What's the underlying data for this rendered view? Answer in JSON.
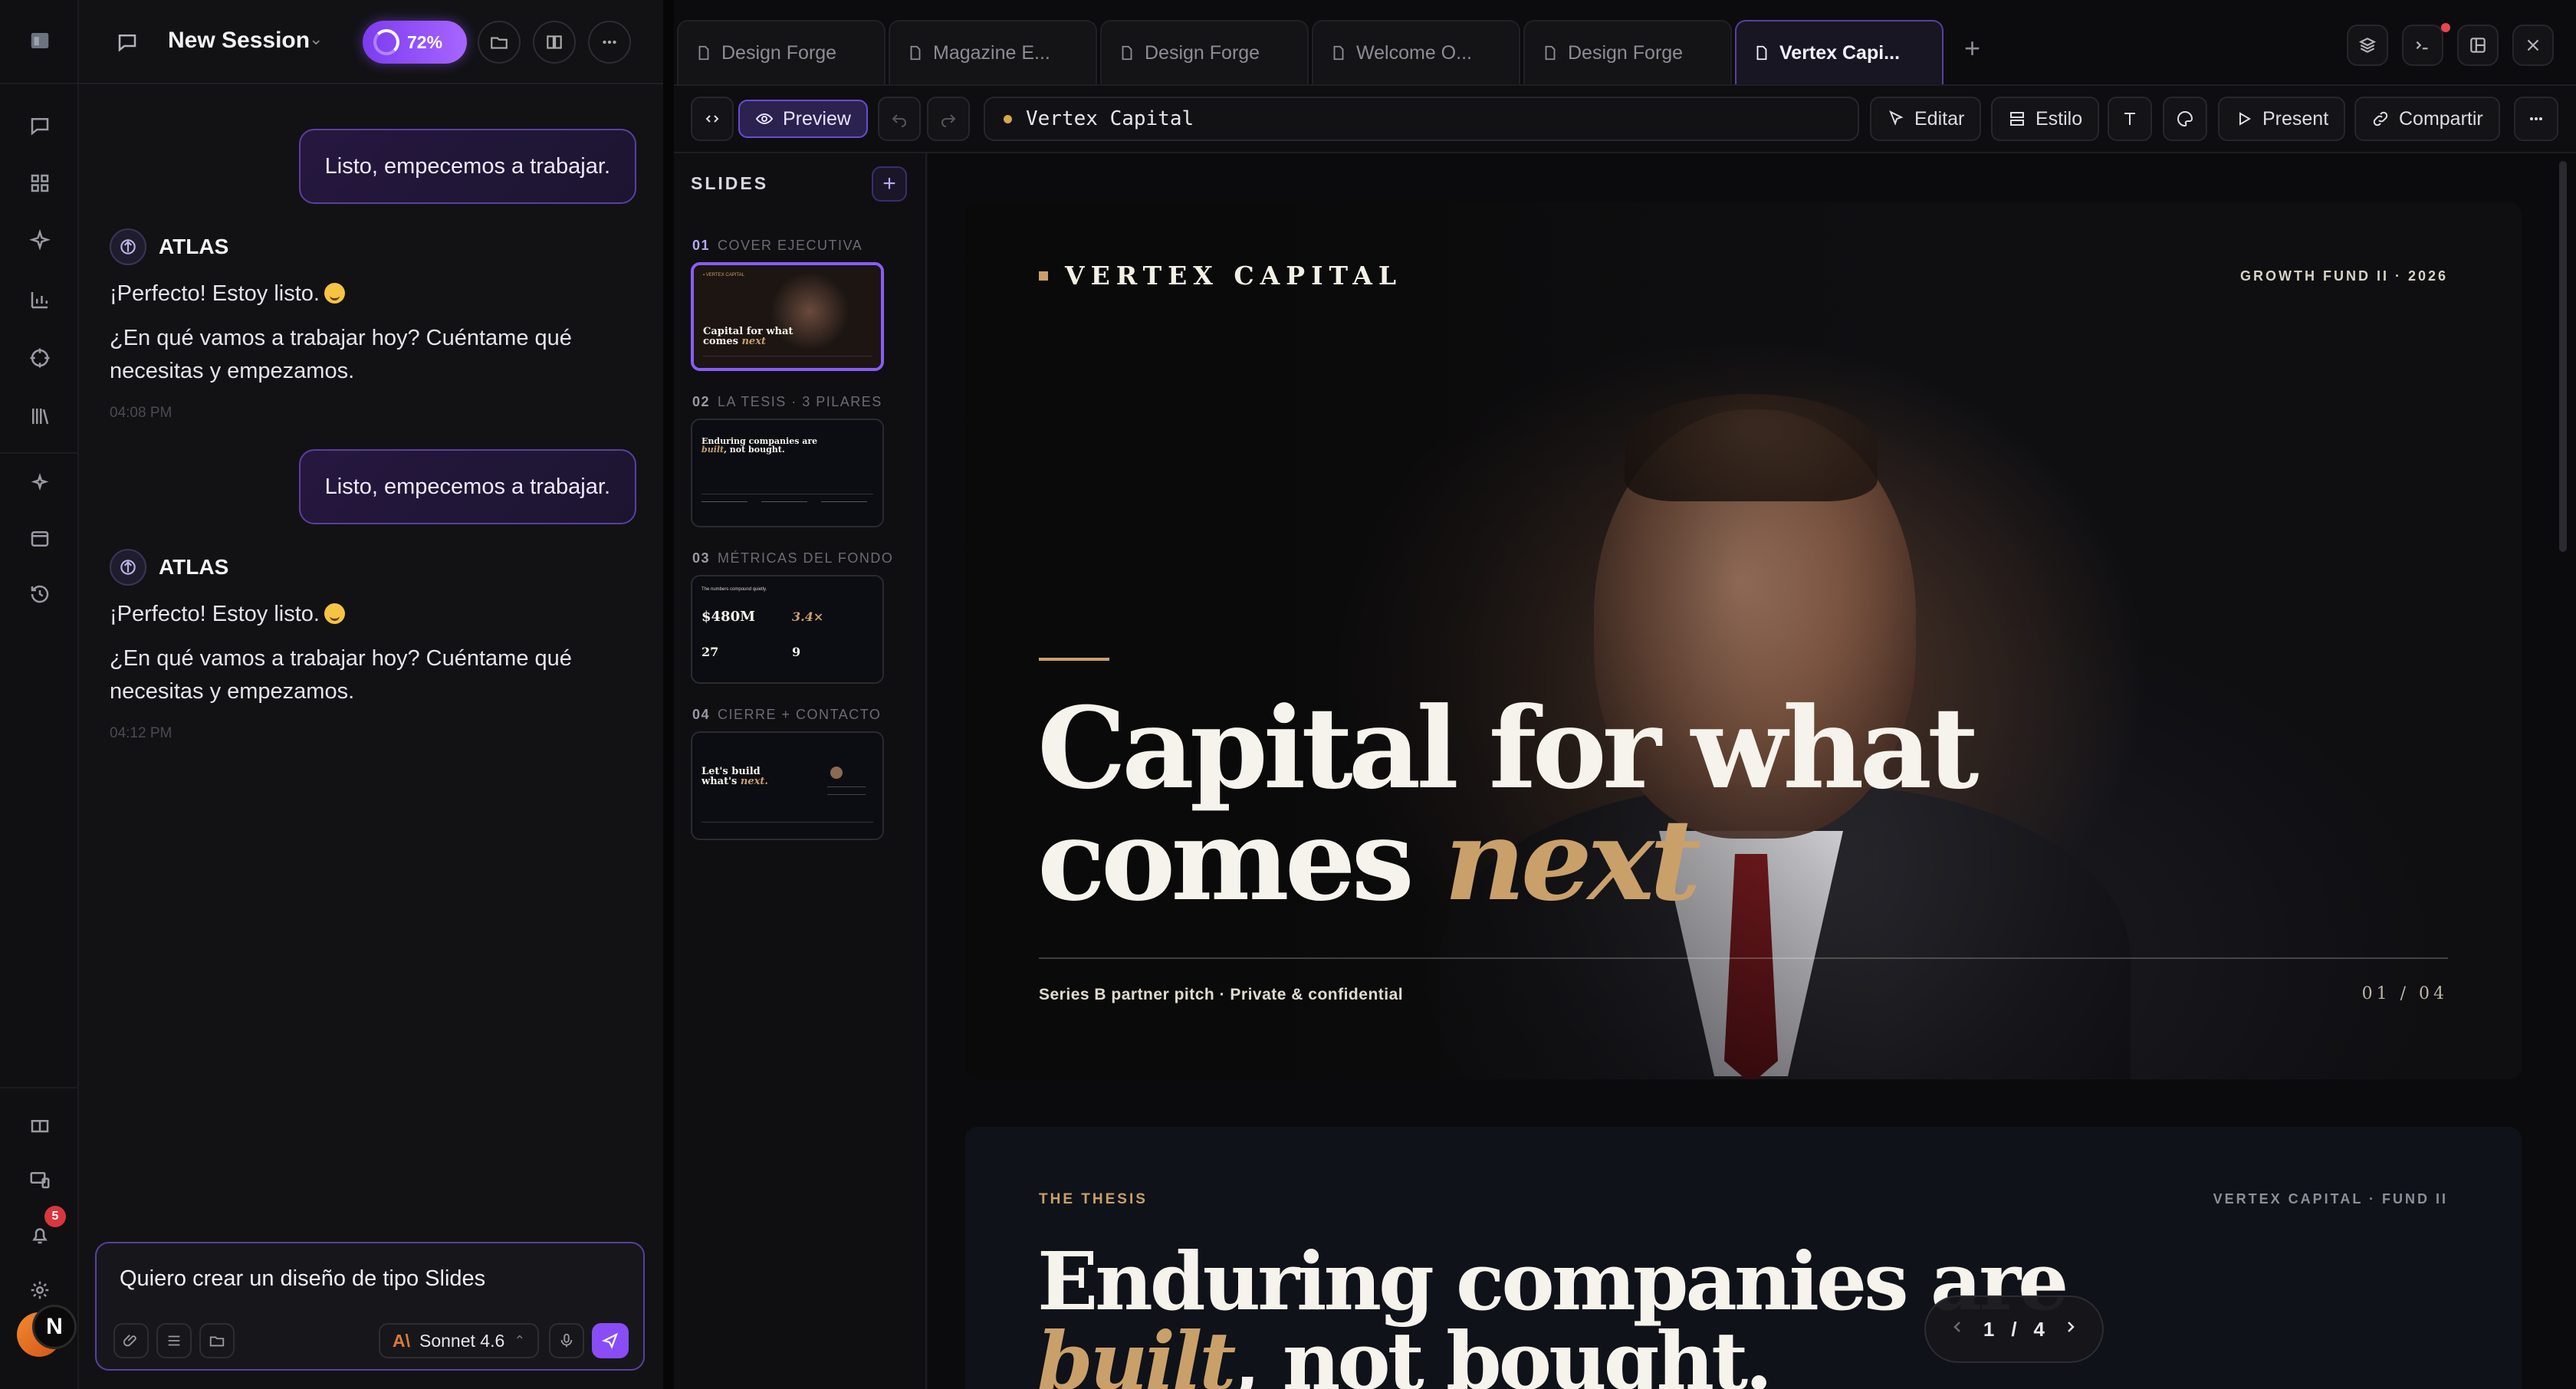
{
  "chat": {
    "title": "New Session",
    "progress": "72%",
    "messages": [
      {
        "type": "user",
        "text": "Listo, empecemos a trabajar."
      },
      {
        "type": "assistant",
        "name": "ATLAS",
        "line1": "¡Perfecto! Estoy listo.",
        "line2": "¿En qué vamos a trabajar hoy? Cuéntame qué necesitas y empezamos.",
        "time": "04:08 PM"
      },
      {
        "type": "user",
        "text": "Listo, empecemos a trabajar."
      },
      {
        "type": "assistant",
        "name": "ATLAS",
        "line1": "¡Perfecto! Estoy listo.",
        "line2": "¿En qué vamos a trabajar hoy? Cuéntame qué necesitas y empezamos.",
        "time": "04:12 PM"
      }
    ],
    "composer": {
      "text": "Quiero crear un diseño de tipo Slides",
      "model": "Sonnet 4.6"
    }
  },
  "rail": {
    "notifications": "5",
    "avatar_initial": "N"
  },
  "tabs": [
    {
      "label": "Design Forge",
      "active": false
    },
    {
      "label": "Magazine E...",
      "active": false
    },
    {
      "label": "Design Forge",
      "active": false
    },
    {
      "label": "Welcome O...",
      "active": false
    },
    {
      "label": "Design Forge",
      "active": false
    },
    {
      "label": "Vertex Capi...",
      "active": true
    }
  ],
  "toolbar": {
    "preview": "Preview",
    "address": "Vertex Capital",
    "edit": "Editar",
    "style": "Estilo",
    "present": "Present",
    "share": "Compartir"
  },
  "slides_panel": {
    "title": "SLIDES",
    "items": [
      {
        "num": "01",
        "label": "COVER EJECUTIVA",
        "thumb_title_1": "Capital for what",
        "thumb_title_2": "comes",
        "thumb_gold": "next"
      },
      {
        "num": "02",
        "label": "LA TESIS · 3 PILARES",
        "thumb_title_1": "Enduring companies are",
        "thumb_gold": "built",
        "thumb_title_2": ", not bought."
      },
      {
        "num": "03",
        "label": "MÉTRICAS DEL FONDO",
        "thumb_kicker": "The numbers compound quietly.",
        "m1": "$480M",
        "m2": "3.4×",
        "m3": "27",
        "m4": "9"
      },
      {
        "num": "04",
        "label": "CIERRE + CONTACTO",
        "thumb_title_1": "Let's build",
        "thumb_title_2": "what's",
        "thumb_gold": "next."
      }
    ]
  },
  "slide1": {
    "brand": "VERTEX CAPITAL",
    "fund": "GROWTH FUND II · 2026",
    "hero_line1": "Capital for what",
    "hero_line2": "comes ",
    "hero_gold": "next",
    "footer": "Series B partner pitch · Private & confidential",
    "page": "01 / 04"
  },
  "slide2": {
    "kicker": "THE THESIS",
    "right": "VERTEX CAPITAL · FUND II",
    "title_line1": "Enduring companies are",
    "title_gold": "built",
    "title_rest": ", not bought."
  },
  "pager": {
    "current": "1",
    "sep": "/",
    "total": "4"
  },
  "colors": {
    "accent": "#8b5cf6",
    "gold": "#c9a06a"
  }
}
